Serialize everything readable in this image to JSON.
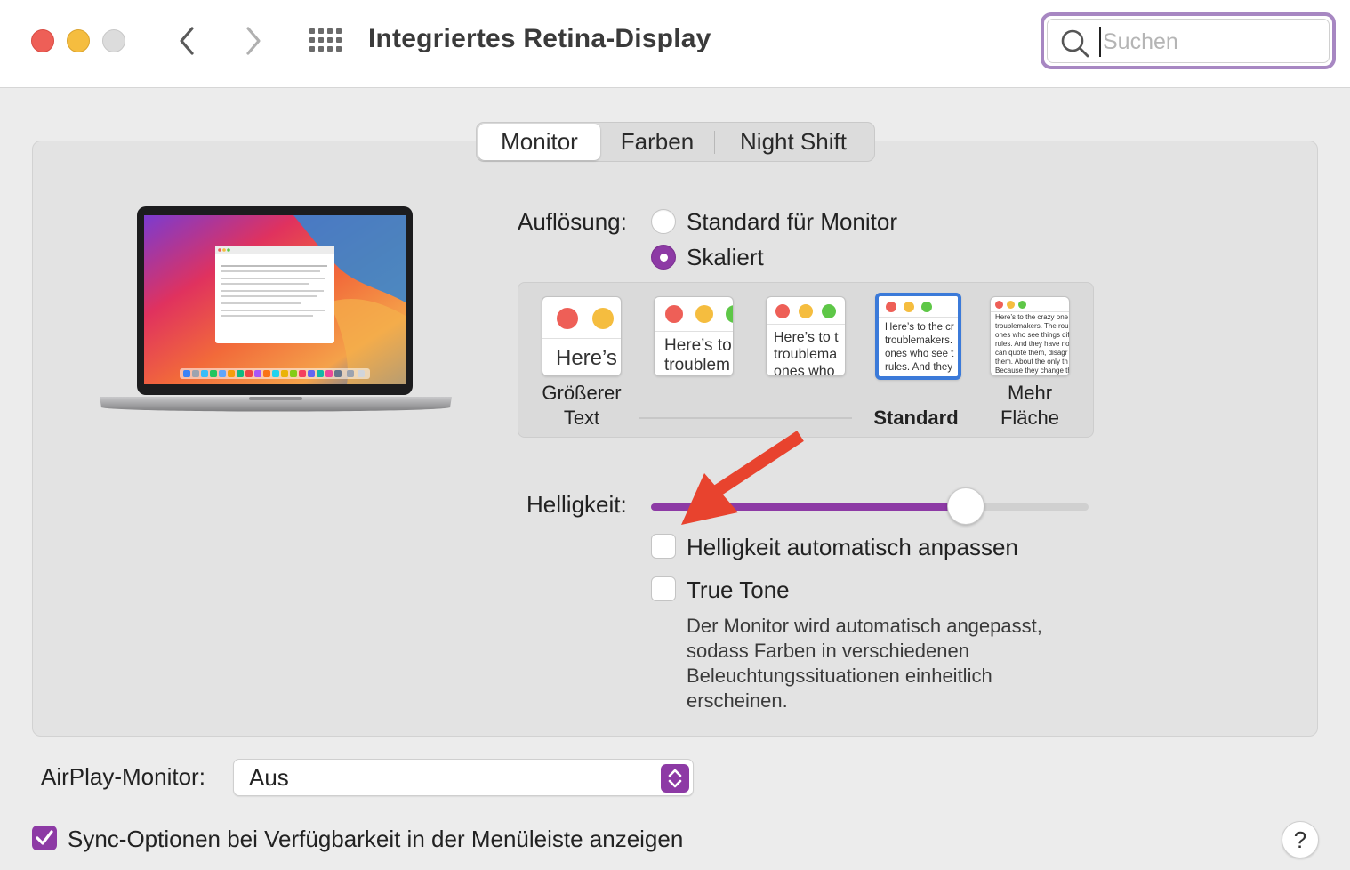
{
  "window": {
    "title": "Integriertes Retina-Display",
    "search_placeholder": "Suchen",
    "search_value": ""
  },
  "tabs": [
    {
      "label": "Monitor",
      "active": true
    },
    {
      "label": "Farben",
      "active": false
    },
    {
      "label": "Night Shift",
      "active": false
    }
  ],
  "resolution": {
    "label": "Auflösung:",
    "options": [
      {
        "label": "Standard für Monitor",
        "selected": false
      },
      {
        "label": "Skaliert",
        "selected": true
      }
    ],
    "scales": [
      {
        "preview": "Here’s",
        "caption": "Größerer\nText",
        "selected": false
      },
      {
        "preview": "Here’s to\ntroublem",
        "caption": "",
        "selected": false
      },
      {
        "preview": "Here’s to t\ntroublema\nones who",
        "caption": "",
        "selected": false
      },
      {
        "preview": "Here’s to the cr\ntroublemakers.\nones who see t\nrules. And they",
        "caption": "Standard",
        "selected": true
      },
      {
        "preview": "Here’s to the crazy one\ntroublemakers. The rou\nones who see things dif\nrules. And they have no\ncan quote them, disagr\nthem. About the only th\nBecause they change th",
        "caption": "Mehr\nFläche",
        "selected": false
      }
    ]
  },
  "brightness": {
    "label": "Helligkeit:",
    "level": 0.72,
    "auto_label": "Helligkeit automatisch anpassen",
    "auto_checked": false
  },
  "true_tone": {
    "label": "True Tone",
    "checked": false,
    "description": "Der Monitor wird automatisch angepasst, sodass Farben in verschiedenen Beleuchtungssituationen einheitlich erscheinen."
  },
  "airplay": {
    "label": "AirPlay-Monitor:",
    "value": "Aus"
  },
  "sync": {
    "label": "Sync-Optionen bei Verfügbarkeit in der Menüleiste anzeigen",
    "checked": true
  },
  "help_label": "?",
  "colors": {
    "accent": "#8d3aa5",
    "selection_blue": "#3b7ad9",
    "arrow_red": "#e8432e"
  },
  "icons": {
    "back": "chevron-left-icon",
    "forward": "chevron-right-icon",
    "grid": "grid-icon",
    "search": "search-icon",
    "popup": "updown-chevron-icon",
    "check": "checkmark-icon"
  }
}
